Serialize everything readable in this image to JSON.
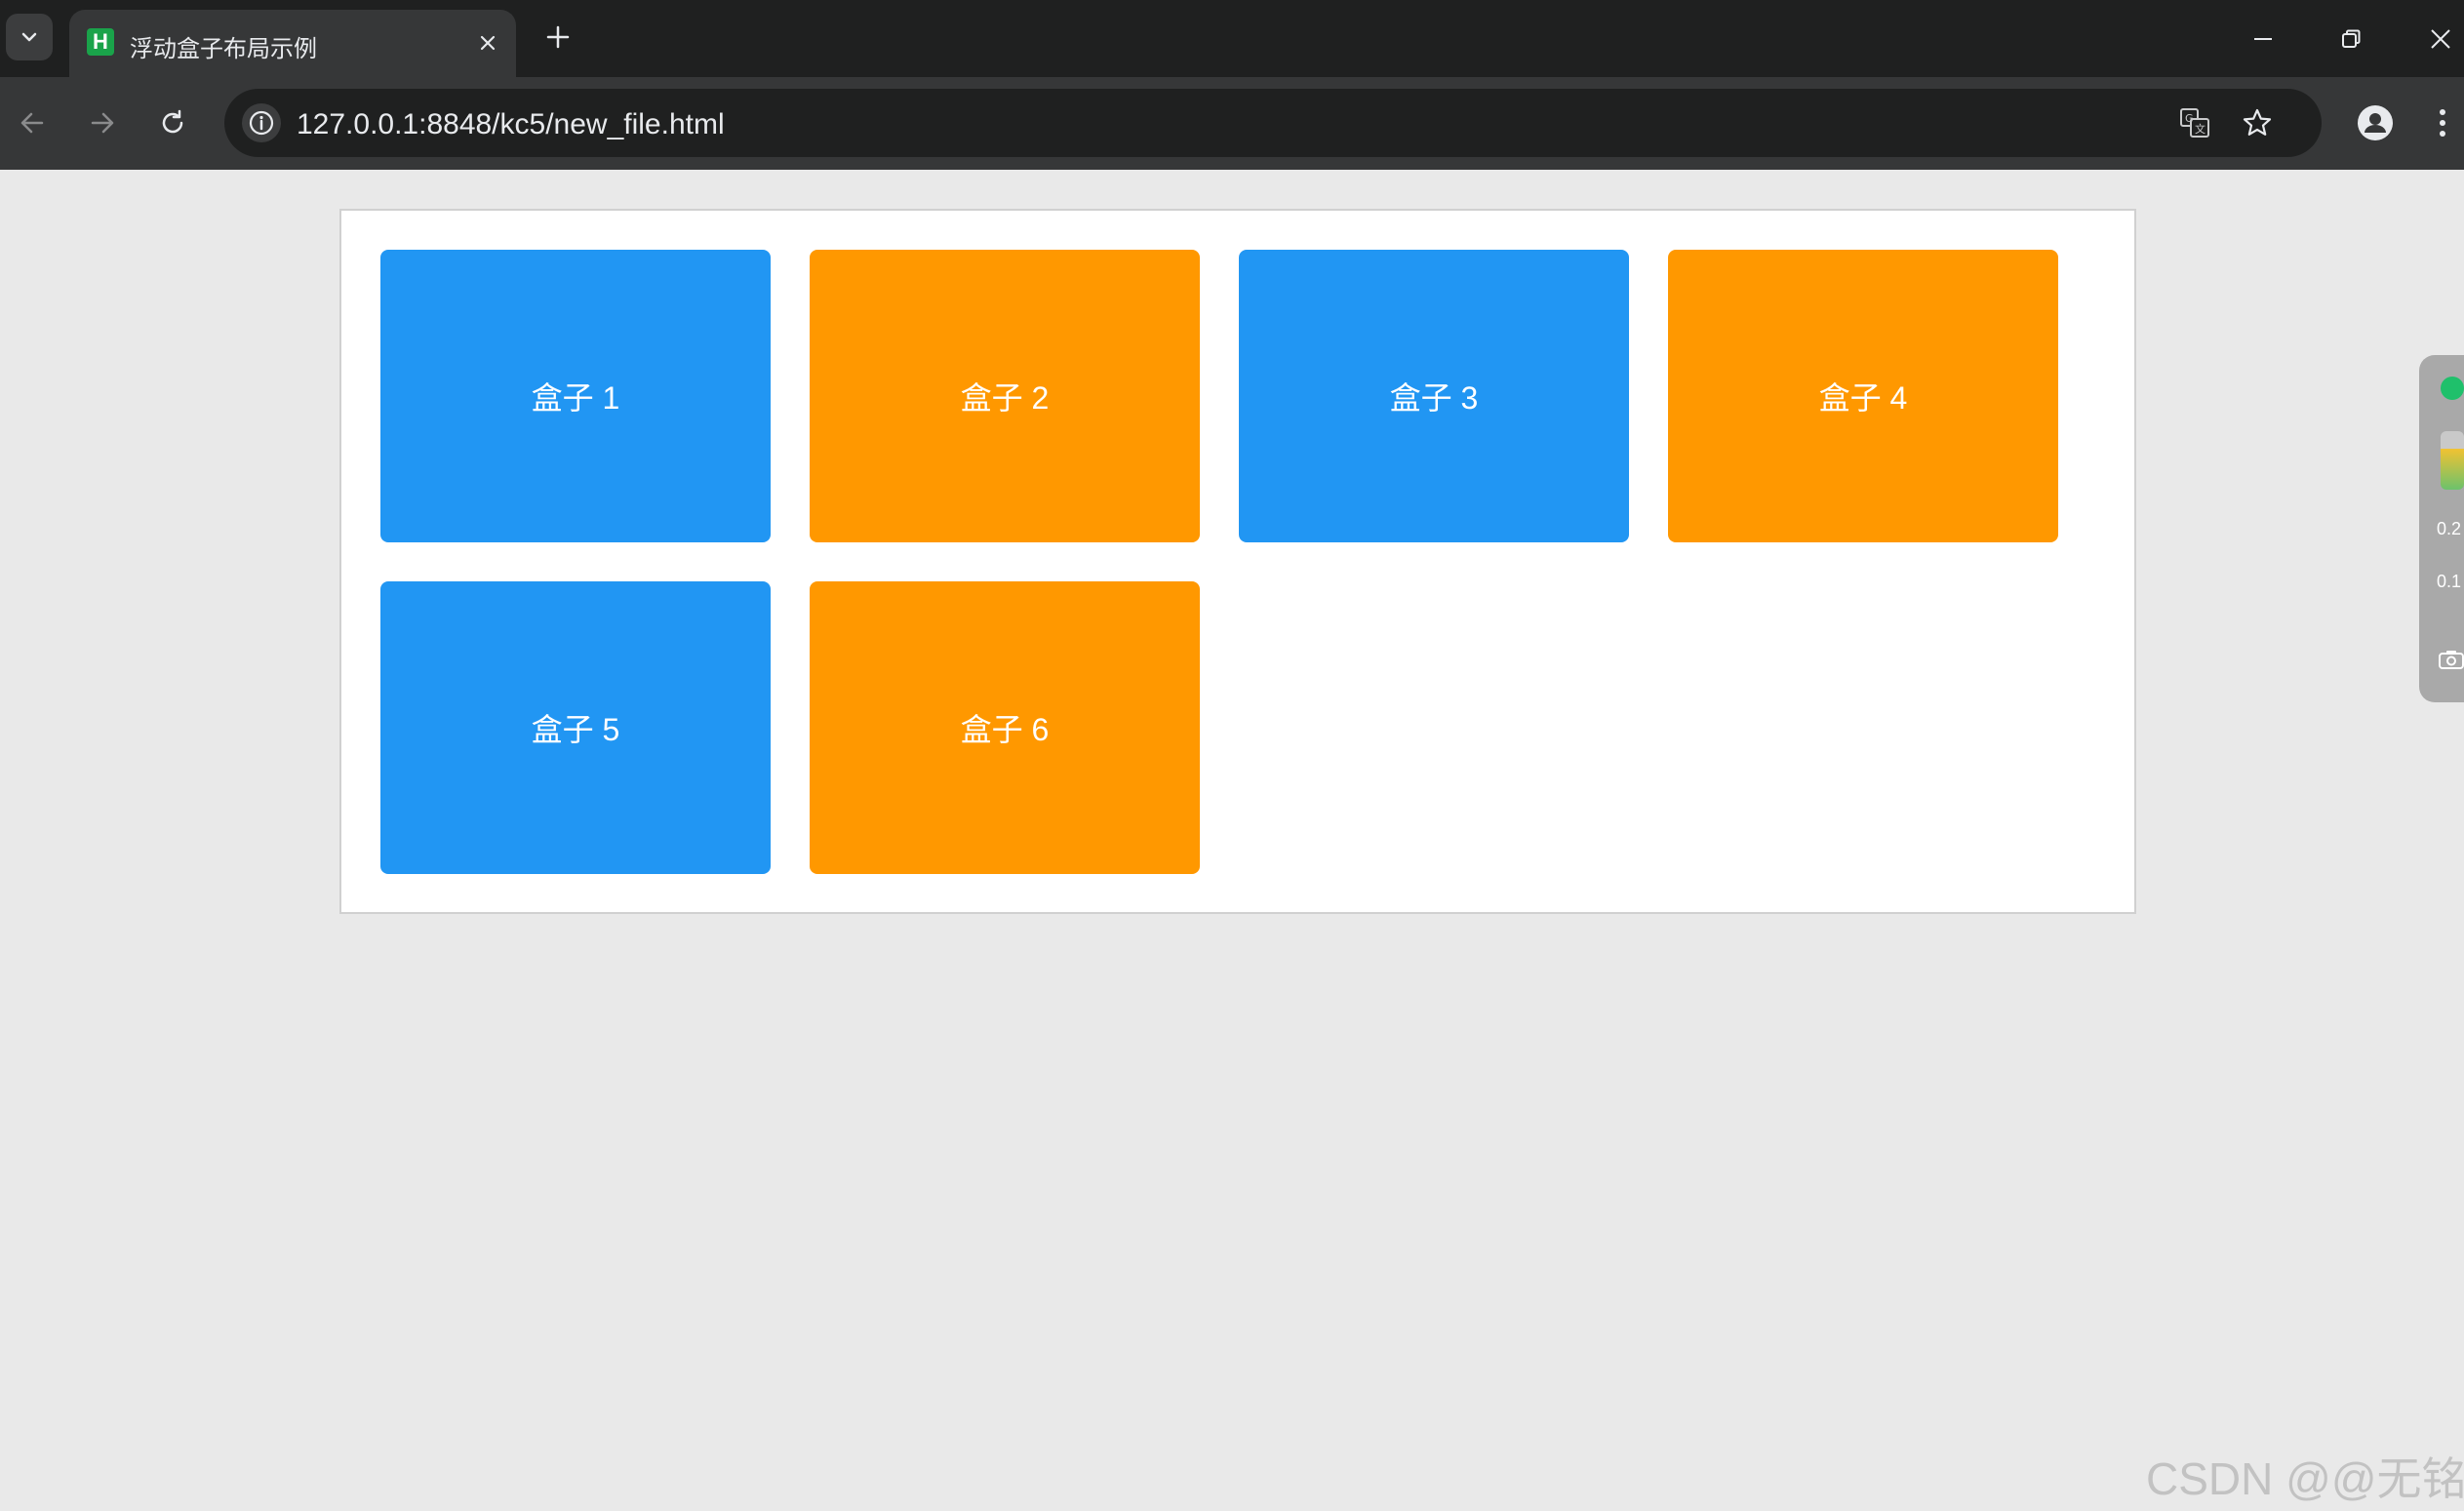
{
  "tab": {
    "favicon_letter": "H",
    "title": "浮动盒子布局示例"
  },
  "toolbar": {
    "url": "127.0.0.1:8848/kc5/new_file.html"
  },
  "page": {
    "boxes": [
      {
        "label": "盒子 1",
        "color": "#2196f3"
      },
      {
        "label": "盒子 2",
        "color": "#ff9800"
      },
      {
        "label": "盒子 3",
        "color": "#2196f3"
      },
      {
        "label": "盒子 4",
        "color": "#ff9800"
      },
      {
        "label": "盒子 5",
        "color": "#2196f3"
      },
      {
        "label": "盒子 6",
        "color": "#ff9800"
      }
    ]
  },
  "side_widget": {
    "upload_value": "0.2",
    "download_value": "0.1",
    "status_color": "#1fc06b"
  },
  "watermark": "CSDN @@无铭",
  "colors": {
    "blue": "#2196f3",
    "orange": "#ff9800",
    "tab_bar_bg": "#1f2020",
    "toolbar_bg": "#363738"
  }
}
